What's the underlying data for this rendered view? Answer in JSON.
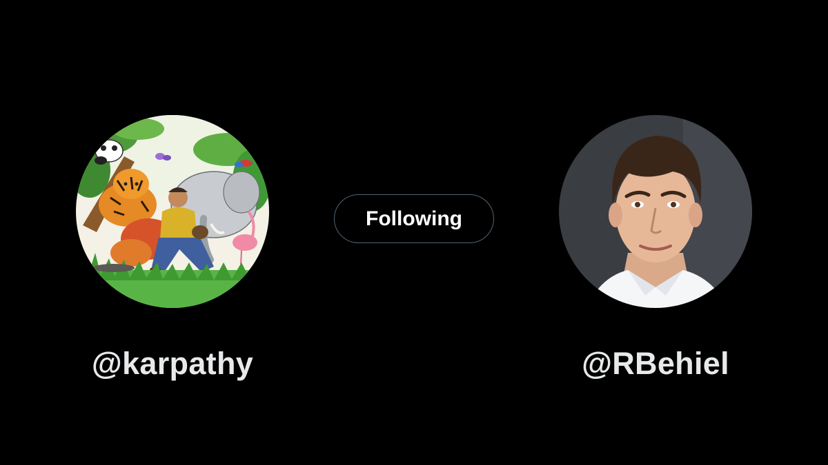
{
  "follow_button": {
    "label": "Following"
  },
  "left_profile": {
    "handle": "@karpathy"
  },
  "right_profile": {
    "handle": "@RBehiel"
  }
}
